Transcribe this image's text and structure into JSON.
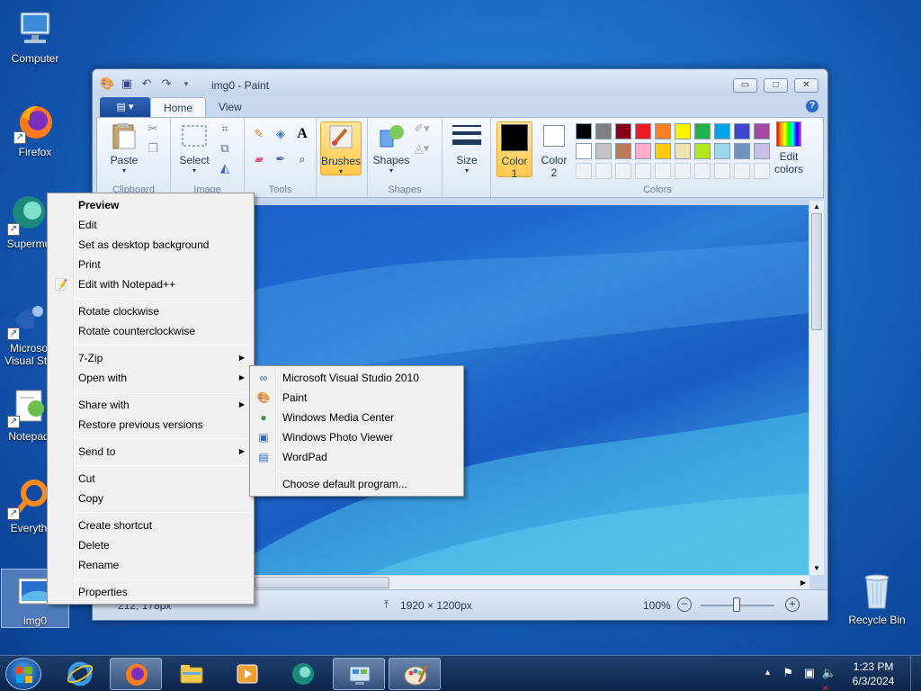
{
  "desktop": {
    "icons": [
      {
        "label": "Computer"
      },
      {
        "label": "Firefox"
      },
      {
        "label": "Supermu"
      },
      {
        "label": "Microso Visual Stu"
      },
      {
        "label": "Notepad"
      },
      {
        "label": "Everyth"
      },
      {
        "label": "img0"
      },
      {
        "label": "Recycle Bin"
      }
    ]
  },
  "paint": {
    "title": "img0 - Paint",
    "tabs": {
      "home": "Home",
      "view": "View"
    },
    "help": "?",
    "ribbon": {
      "clipboard": {
        "label": "Clipboard",
        "paste": "Paste"
      },
      "image": {
        "label": "Image",
        "select": "Select"
      },
      "tools": {
        "label": "Tools",
        "text_tool": "A"
      },
      "brushes": "Brushes",
      "shapes": {
        "label": "Shapes",
        "shapes_btn": "Shapes"
      },
      "size": "Size",
      "colors": {
        "label": "Colors",
        "color1": "Color",
        "color1_num": "1",
        "color2": "Color",
        "color2_num": "2",
        "edit": "Edit",
        "edit2": "colors",
        "row1": [
          "#000000",
          "#7f7f7f",
          "#880015",
          "#ed1c24",
          "#ff7f27",
          "#fff200",
          "#22b14c",
          "#00a2e8",
          "#3f48cc",
          "#a349a4"
        ],
        "row2": [
          "#ffffff",
          "#c3c3c3",
          "#b97a57",
          "#ffaec9",
          "#ffc90e",
          "#efe4b0",
          "#b5e61d",
          "#99d9ea",
          "#7092be",
          "#c8bfe7"
        ]
      }
    },
    "status": {
      "position": "212, 178px",
      "dimensions": "1920 × 1200px",
      "zoom": "100%"
    }
  },
  "context_menu": {
    "items": [
      {
        "label": "Preview"
      },
      {
        "label": "Edit"
      },
      {
        "label": "Set as desktop background"
      },
      {
        "label": "Print"
      },
      {
        "label": "Edit with Notepad++"
      },
      {
        "label": "Rotate clockwise"
      },
      {
        "label": "Rotate counterclockwise"
      },
      {
        "label": "7-Zip"
      },
      {
        "label": "Open with"
      },
      {
        "label": "Share with"
      },
      {
        "label": "Restore previous versions"
      },
      {
        "label": "Send to"
      },
      {
        "label": "Cut"
      },
      {
        "label": "Copy"
      },
      {
        "label": "Create shortcut"
      },
      {
        "label": "Delete"
      },
      {
        "label": "Rename"
      },
      {
        "label": "Properties"
      }
    ]
  },
  "open_with_menu": {
    "items": [
      {
        "label": "Microsoft Visual Studio 2010"
      },
      {
        "label": "Paint"
      },
      {
        "label": "Windows Media Center"
      },
      {
        "label": "Windows Photo Viewer"
      },
      {
        "label": "WordPad"
      },
      {
        "label": "Choose default program..."
      }
    ]
  },
  "taskbar": {
    "clock_time": "1:23 PM",
    "clock_date": "6/3/2024"
  }
}
